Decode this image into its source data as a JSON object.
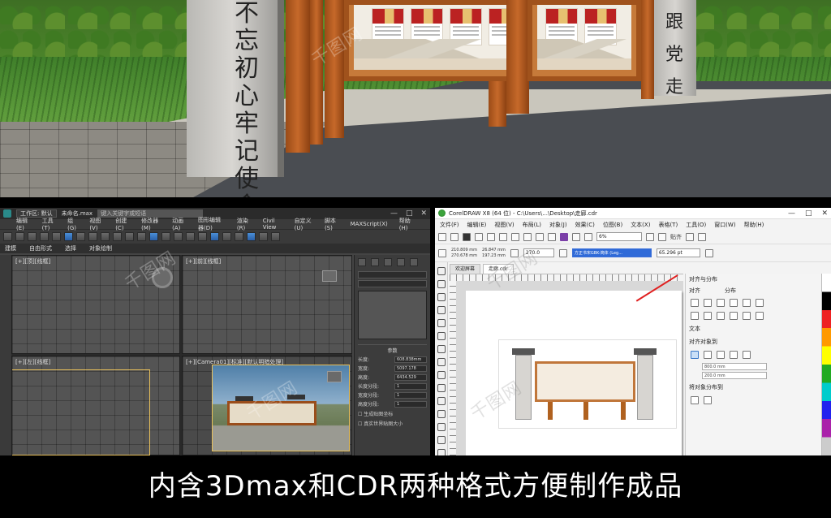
{
  "scene": {
    "pillar_left_text": "不忘初心牢记使命",
    "pillar_right_text": "跟党走"
  },
  "max": {
    "workspace": "工作区: 默认",
    "filename": "未命名.max",
    "search_placeholder": "键入关键字或短语",
    "menus": [
      "编辑(E)",
      "工具(T)",
      "组(G)",
      "视图(V)",
      "创建(C)",
      "修改器(M)",
      "动画(A)",
      "图形编辑器(D)",
      "渲染(R)",
      "Civil View",
      "自定义(U)",
      "脚本(S)",
      "MAXScript(X)",
      "帮助(H)"
    ],
    "subtabs": [
      "建模",
      "自由形式",
      "选择",
      "对象绘制"
    ],
    "viewport_labels": [
      "[+][顶][线框]",
      "[+][前][线框]",
      "[+][左][线框]",
      "[+][Camera01][标准][默认明暗处理]"
    ],
    "panel_section": "参数",
    "params": [
      {
        "label": "长度:",
        "value": "608.838mm"
      },
      {
        "label": "宽度:",
        "value": "5097.178"
      },
      {
        "label": "高度:",
        "value": "6434.529"
      },
      {
        "label": "长度分段:",
        "value": "1"
      },
      {
        "label": "宽度分段:",
        "value": "1"
      },
      {
        "label": "高度分段:",
        "value": "1"
      }
    ],
    "checks": [
      "生成贴图坐标",
      "真实世界贴图大小"
    ]
  },
  "cdr": {
    "title": "CorelDRAW X8 (64 位) - C:\\Users\\...\\Desktop\\走廊.cdr",
    "menus": [
      "文件(F)",
      "编辑(E)",
      "视图(V)",
      "布局(L)",
      "对象(J)",
      "效果(C)",
      "位图(B)",
      "文本(X)",
      "表格(T)",
      "工具(O)",
      "窗口(W)",
      "帮助(H)"
    ],
    "zoom": "6%",
    "snap": "贴齐",
    "x": "210.809 mm",
    "y": "270.678 mm",
    "w": "26.847 mm",
    "h": "197.23 mm",
    "rotation": "270.0",
    "font": "方正书宋GBK-简体 (Leg...",
    "font_size": "65.296 pt",
    "tabs": [
      "欢迎屏幕",
      "走廊.cdr"
    ],
    "dock_headers": [
      "对齐与分布"
    ],
    "dock_labels": [
      "对齐",
      "分布",
      "文本",
      "对齐对象到",
      "将对象分布到"
    ],
    "dock_fields": [
      "800.0 mm",
      "200.0 mm"
    ]
  },
  "caption": "内含3Dmax和CDR两种格式方便制作成品",
  "watermark": "千图网"
}
